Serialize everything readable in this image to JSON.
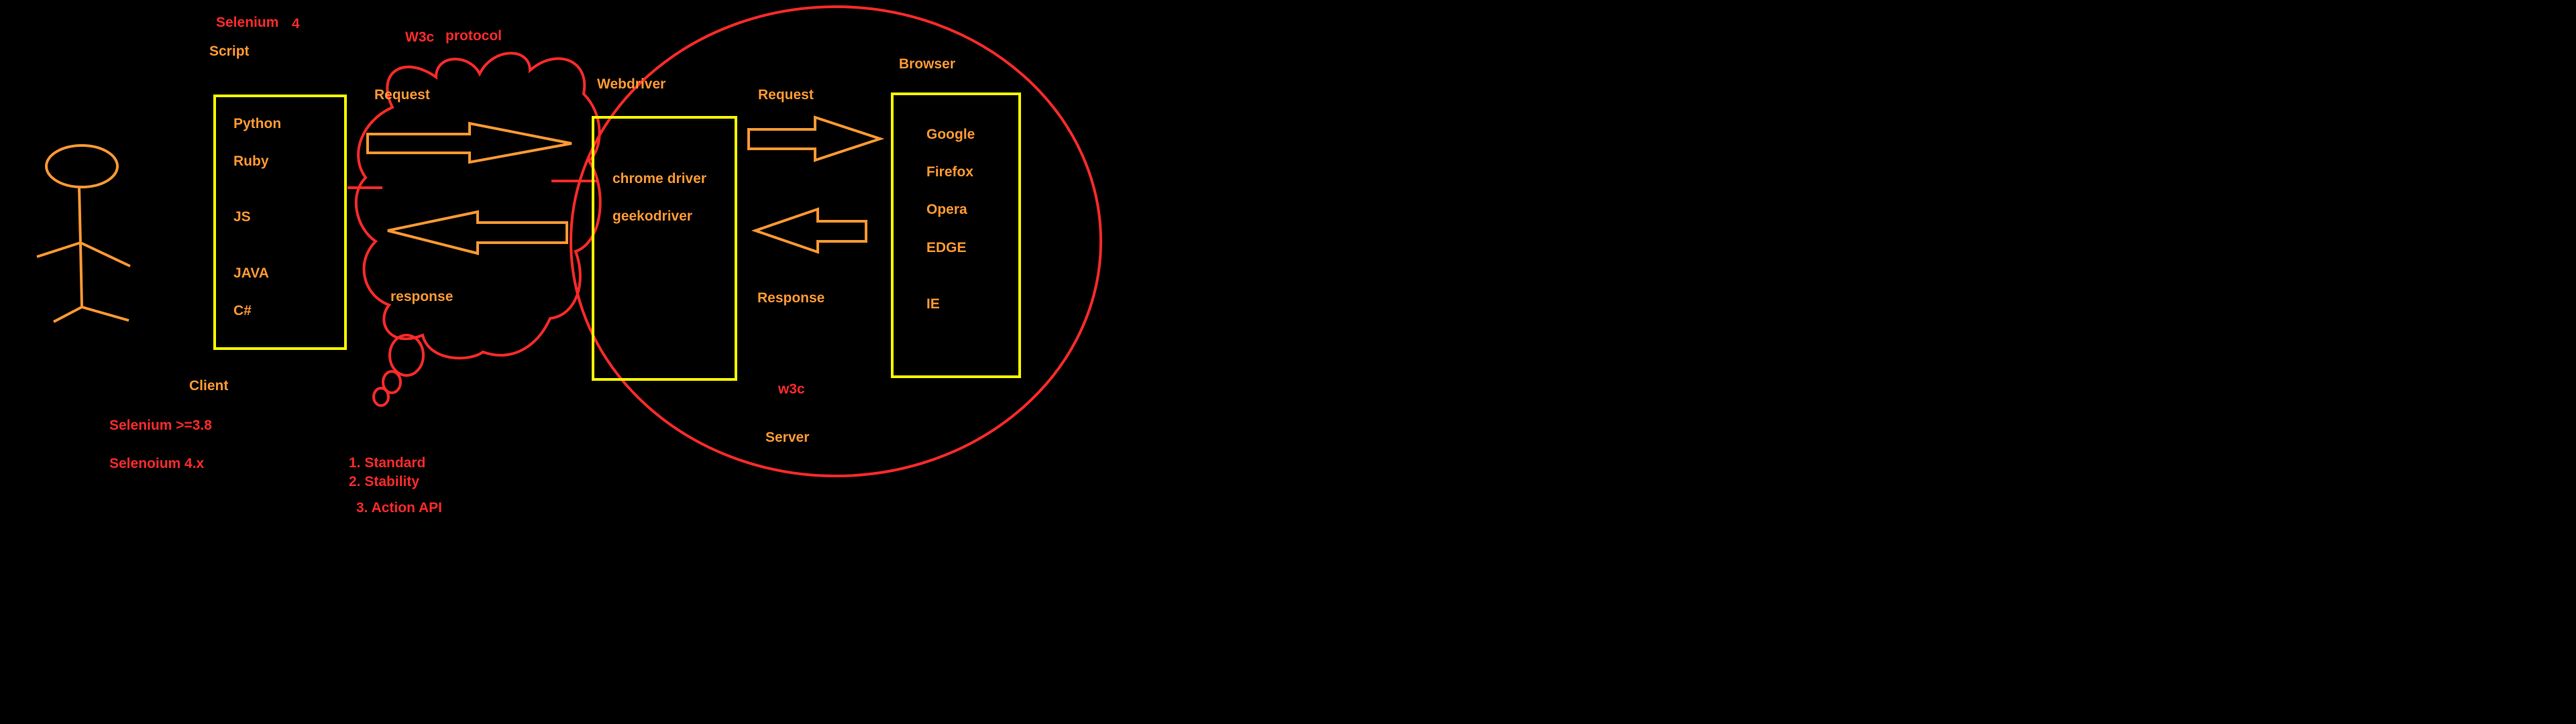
{
  "colors": {
    "background": "#000000",
    "orange": "#ff9933",
    "red": "#ff2a2a",
    "yellow": "#ffff00"
  },
  "top": {
    "selenium_label": "Selenium",
    "selenium_version": "4",
    "script_label": "Script",
    "w3c_label": "W3c",
    "protocol_label": "protocol"
  },
  "client_box": {
    "languages": [
      "Python",
      "Ruby",
      "JS",
      "JAVA",
      "C#"
    ],
    "caption": "Client"
  },
  "webdriver_box": {
    "title": "Webdriver",
    "drivers": [
      "chrome driver",
      "geekodriver"
    ]
  },
  "browser_box": {
    "title": "Browser",
    "browsers": [
      "Google",
      "Firefox",
      "Opera",
      "EDGE",
      "IE"
    ]
  },
  "arrows": {
    "request_left": "Request",
    "response_left": "response",
    "request_right": "Request",
    "response_right": "Response"
  },
  "server": {
    "w3c_label": "w3c",
    "caption": "Server"
  },
  "notes_left": [
    "Selenium >=3.8",
    "Selenoium 4.x"
  ],
  "notes_features": [
    "1. Standard",
    "2. Stability",
    "3. Action API"
  ]
}
